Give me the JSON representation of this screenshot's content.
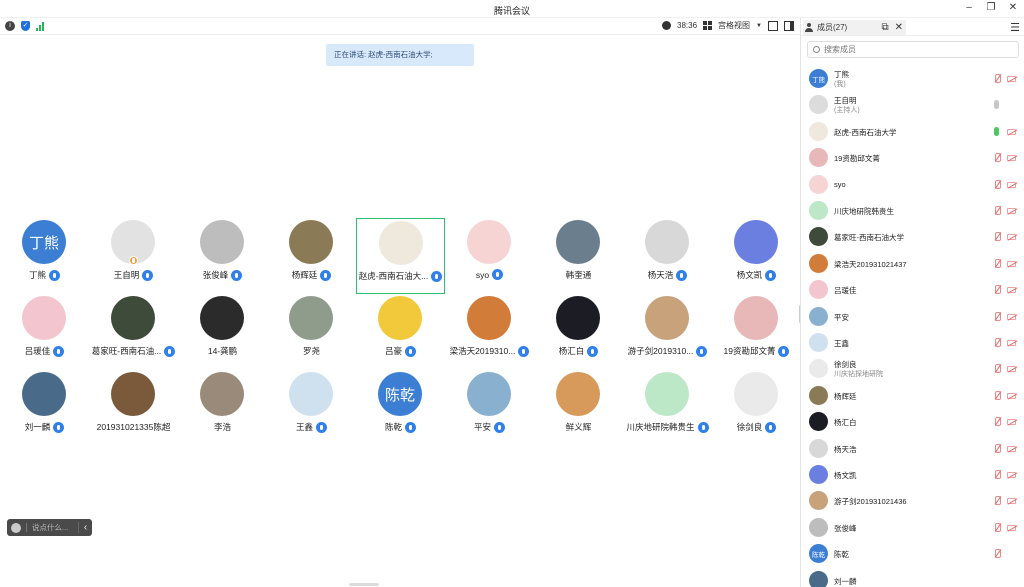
{
  "window": {
    "title": "腾讯会议"
  },
  "toolbar": {
    "info_icon": "info-icon",
    "shield_icon": "shield-icon",
    "signal_icon": "signal-icon",
    "timer": "38:36",
    "view_label": "宫格视图"
  },
  "speaking": {
    "text": "正在讲话: 赵虎-西南石油大学;"
  },
  "grid": {
    "tiles": [
      {
        "name": "丁熊",
        "avatar_text": "丁熊",
        "avatar_color": "#3b7ed4",
        "mic": true
      },
      {
        "name": "王自明",
        "avatar_text": "",
        "avatar_color": "#e2e2e2",
        "mic": true,
        "host": true
      },
      {
        "name": "张俊峰",
        "avatar_text": "",
        "avatar_color": "#bdbdbd",
        "mic": true
      },
      {
        "name": "杨辉廷",
        "avatar_text": "",
        "avatar_color": "#8a7a55",
        "mic": true
      },
      {
        "name": "赵虎-西南石油大...",
        "avatar_text": "",
        "avatar_color": "#efe8dc",
        "mic": true,
        "active": true
      },
      {
        "name": "syo",
        "avatar_text": "",
        "avatar_color": "#f6d4d4",
        "mic": true
      },
      {
        "name": "韩奎通",
        "avatar_text": "",
        "avatar_color": "#6b7e8e",
        "mic": false
      },
      {
        "name": "杨天浩",
        "avatar_text": "",
        "avatar_color": "#d8d8d8",
        "mic": true
      },
      {
        "name": "杨文凯",
        "avatar_text": "",
        "avatar_color": "#6a7fe0",
        "mic": true
      },
      {
        "name": "吕瑗佳",
        "avatar_text": "",
        "avatar_color": "#f3c6cf",
        "mic": true
      },
      {
        "name": "葛家旺-西南石油...",
        "avatar_text": "",
        "avatar_color": "#3e4a3a",
        "mic": true
      },
      {
        "name": "14-龚鹏",
        "avatar_text": "",
        "avatar_color": "#2b2b2b",
        "mic": false
      },
      {
        "name": "罗尧",
        "avatar_text": "",
        "avatar_color": "#8f9c8c",
        "mic": false
      },
      {
        "name": "吕豪",
        "avatar_text": "",
        "avatar_color": "#f1c93a",
        "mic": true
      },
      {
        "name": "梁浩天2019310...",
        "avatar_text": "",
        "avatar_color": "#d27c3a",
        "mic": true
      },
      {
        "name": "杨汇白",
        "avatar_text": "",
        "avatar_color": "#1c1c24",
        "mic": true
      },
      {
        "name": "游子剑2019310...",
        "avatar_text": "",
        "avatar_color": "#c7a27a",
        "mic": true
      },
      {
        "name": "19资勘邱文菁",
        "avatar_text": "",
        "avatar_color": "#e8b8b8",
        "mic": true
      },
      {
        "name": "刘一麟",
        "avatar_text": "",
        "avatar_color": "#4a6a8a",
        "mic": true
      },
      {
        "name": "201931021335陈超",
        "avatar_text": "",
        "avatar_color": "#7a5a3a",
        "mic": false
      },
      {
        "name": "李浩",
        "avatar_text": "",
        "avatar_color": "#9a8a7a",
        "mic": false
      },
      {
        "name": "王鑫",
        "avatar_text": "",
        "avatar_color": "#cfe0ef",
        "mic": true
      },
      {
        "name": "陈乾",
        "avatar_text": "陈乾",
        "avatar_color": "#3b7ed4",
        "mic": true
      },
      {
        "name": "平安",
        "avatar_text": "",
        "avatar_color": "#8ab0d0",
        "mic": true
      },
      {
        "name": "鲜义辉",
        "avatar_text": "",
        "avatar_color": "#d89a5a",
        "mic": false
      },
      {
        "name": "川庆地研院韩贵生",
        "avatar_text": "",
        "avatar_color": "#bde8c8",
        "mic": true
      },
      {
        "name": "徐剑良",
        "avatar_text": "",
        "avatar_color": "#eaeaea",
        "mic": true
      }
    ]
  },
  "chat": {
    "placeholder": "说点什么...",
    "emoji_icon": "emoji-icon",
    "collapse_icon": "chevron-left-icon"
  },
  "panel": {
    "title": "成员(27)",
    "search_placeholder": "搜索成员",
    "members": [
      {
        "name": "丁熊",
        "sub": "(我)",
        "avatar_text": "丁熊",
        "avatar_color": "#3b7ed4",
        "mic": "off",
        "cam": "off"
      },
      {
        "name": "王自明",
        "sub": "(主持人)",
        "avatar_text": "",
        "avatar_color": "#dcdcdc",
        "mic": "gray",
        "cam": "none"
      },
      {
        "name": "赵虎-西南石油大学",
        "sub": "",
        "avatar_text": "",
        "avatar_color": "#efe8dc",
        "mic": "green",
        "cam": "off"
      },
      {
        "name": "19资勘邱文菁",
        "sub": "",
        "avatar_text": "",
        "avatar_color": "#e8b8b8",
        "mic": "off",
        "cam": "off"
      },
      {
        "name": "syo",
        "sub": "",
        "avatar_text": "",
        "avatar_color": "#f6d4d4",
        "mic": "off",
        "cam": "off"
      },
      {
        "name": "川庆地研院韩贵生",
        "sub": "",
        "avatar_text": "",
        "avatar_color": "#bde8c8",
        "mic": "off",
        "cam": "off"
      },
      {
        "name": "葛家旺-西南石油大学",
        "sub": "",
        "avatar_text": "",
        "avatar_color": "#3e4a3a",
        "mic": "off",
        "cam": "off"
      },
      {
        "name": "梁浩天201931021437",
        "sub": "",
        "avatar_text": "",
        "avatar_color": "#d27c3a",
        "mic": "off",
        "cam": "off"
      },
      {
        "name": "吕瑗佳",
        "sub": "",
        "avatar_text": "",
        "avatar_color": "#f3c6cf",
        "mic": "off",
        "cam": "off"
      },
      {
        "name": "平安",
        "sub": "",
        "avatar_text": "",
        "avatar_color": "#8ab0d0",
        "mic": "off",
        "cam": "off"
      },
      {
        "name": "王鑫",
        "sub": "",
        "avatar_text": "",
        "avatar_color": "#cfe0ef",
        "mic": "off",
        "cam": "off"
      },
      {
        "name": "徐剑良",
        "sub": "川庆钻探地研院",
        "avatar_text": "",
        "avatar_color": "#eaeaea",
        "mic": "off",
        "cam": "off"
      },
      {
        "name": "杨辉廷",
        "sub": "",
        "avatar_text": "",
        "avatar_color": "#8a7a55",
        "mic": "off",
        "cam": "off"
      },
      {
        "name": "杨汇白",
        "sub": "",
        "avatar_text": "",
        "avatar_color": "#1c1c24",
        "mic": "off",
        "cam": "off"
      },
      {
        "name": "杨天浩",
        "sub": "",
        "avatar_text": "",
        "avatar_color": "#d8d8d8",
        "mic": "off",
        "cam": "off"
      },
      {
        "name": "杨文凯",
        "sub": "",
        "avatar_text": "",
        "avatar_color": "#6a7fe0",
        "mic": "off",
        "cam": "off"
      },
      {
        "name": "游子剑201931021436",
        "sub": "",
        "avatar_text": "",
        "avatar_color": "#c7a27a",
        "mic": "off",
        "cam": "off"
      },
      {
        "name": "张俊峰",
        "sub": "",
        "avatar_text": "",
        "avatar_color": "#bdbdbd",
        "mic": "off",
        "cam": "off"
      },
      {
        "name": "陈乾",
        "sub": "",
        "avatar_text": "陈乾",
        "avatar_color": "#3b7ed4",
        "mic": "off",
        "cam": "none"
      },
      {
        "name": "刘一麟",
        "sub": "",
        "avatar_text": "",
        "avatar_color": "#4a6a8a",
        "mic": "none",
        "cam": "none"
      }
    ]
  }
}
